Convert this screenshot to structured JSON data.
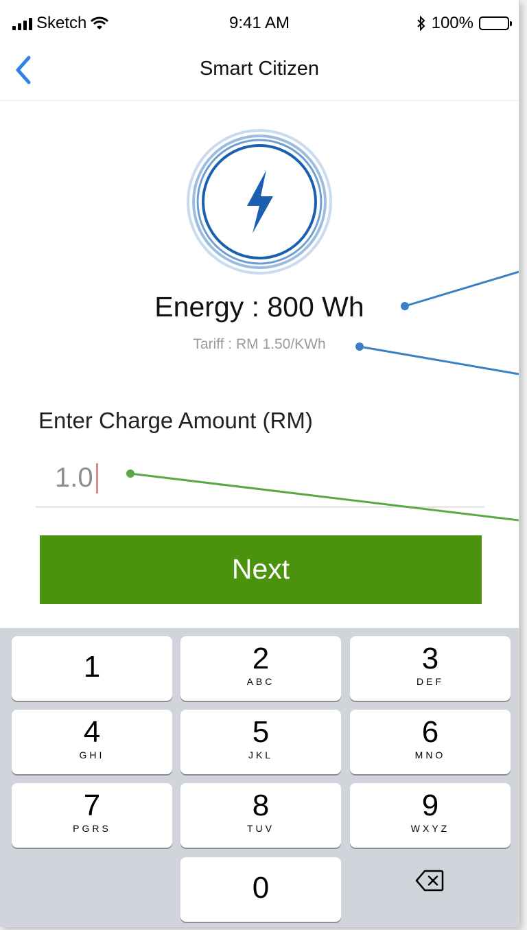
{
  "status_bar": {
    "carrier": "Sketch",
    "time": "9:41 AM",
    "battery": "100%"
  },
  "nav": {
    "title": "Smart Citizen"
  },
  "energy": {
    "label": "Energy : 800 Wh",
    "tariff": "Tariff : RM 1.50/KWh",
    "icon": "lightning-bolt-icon",
    "accent": "#1a5fb0"
  },
  "charge": {
    "label": "Enter Charge Amount (RM)",
    "value": "1.0"
  },
  "next_button": {
    "label": "Next",
    "color": "#4c930d"
  },
  "keyboard": {
    "keys": [
      {
        "num": "1",
        "letters": ""
      },
      {
        "num": "2",
        "letters": "ABC"
      },
      {
        "num": "3",
        "letters": "DEF"
      },
      {
        "num": "4",
        "letters": "GHI"
      },
      {
        "num": "5",
        "letters": "JKL"
      },
      {
        "num": "6",
        "letters": "MNO"
      },
      {
        "num": "7",
        "letters": "PGRS"
      },
      {
        "num": "8",
        "letters": "TUV"
      },
      {
        "num": "9",
        "letters": "WXYZ"
      },
      {
        "num": "0",
        "letters": ""
      }
    ],
    "delete_icon": "backspace-icon"
  }
}
